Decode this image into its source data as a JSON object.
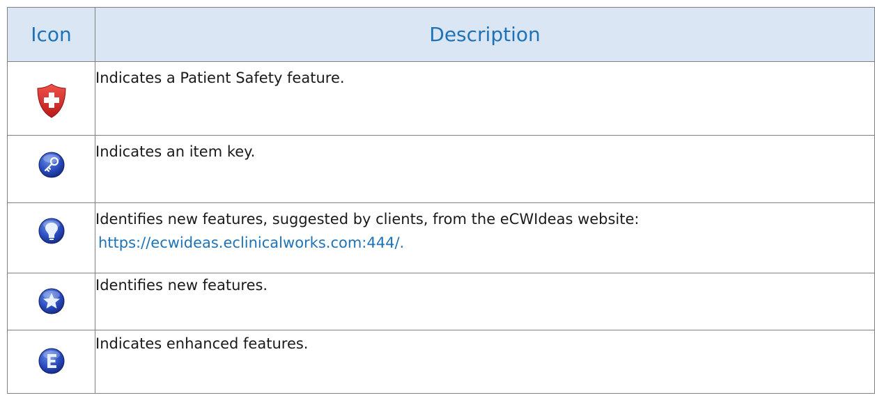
{
  "table": {
    "headers": {
      "icon": "Icon",
      "description": "Description"
    },
    "rows": [
      {
        "icon": "patient-safety-shield-icon",
        "description": "Indicates a Patient Safety feature."
      },
      {
        "icon": "item-key-icon",
        "description": "Indicates an item key."
      },
      {
        "icon": "lightbulb-icon",
        "description": "Identifies new features, suggested by clients, from the eCWIdeas website:",
        "link": "https://ecwideas.eclinicalworks.com:444/."
      },
      {
        "icon": "star-icon",
        "description": "Identifies new features."
      },
      {
        "icon": "enhanced-e-icon",
        "description": "Indicates enhanced features."
      }
    ]
  },
  "colors": {
    "header_background": "#dae6f3",
    "header_text": "#1e73b8",
    "link": "#1e73b8",
    "shield_red": "#d42a28",
    "icon_blue": "#1f3fa8"
  }
}
